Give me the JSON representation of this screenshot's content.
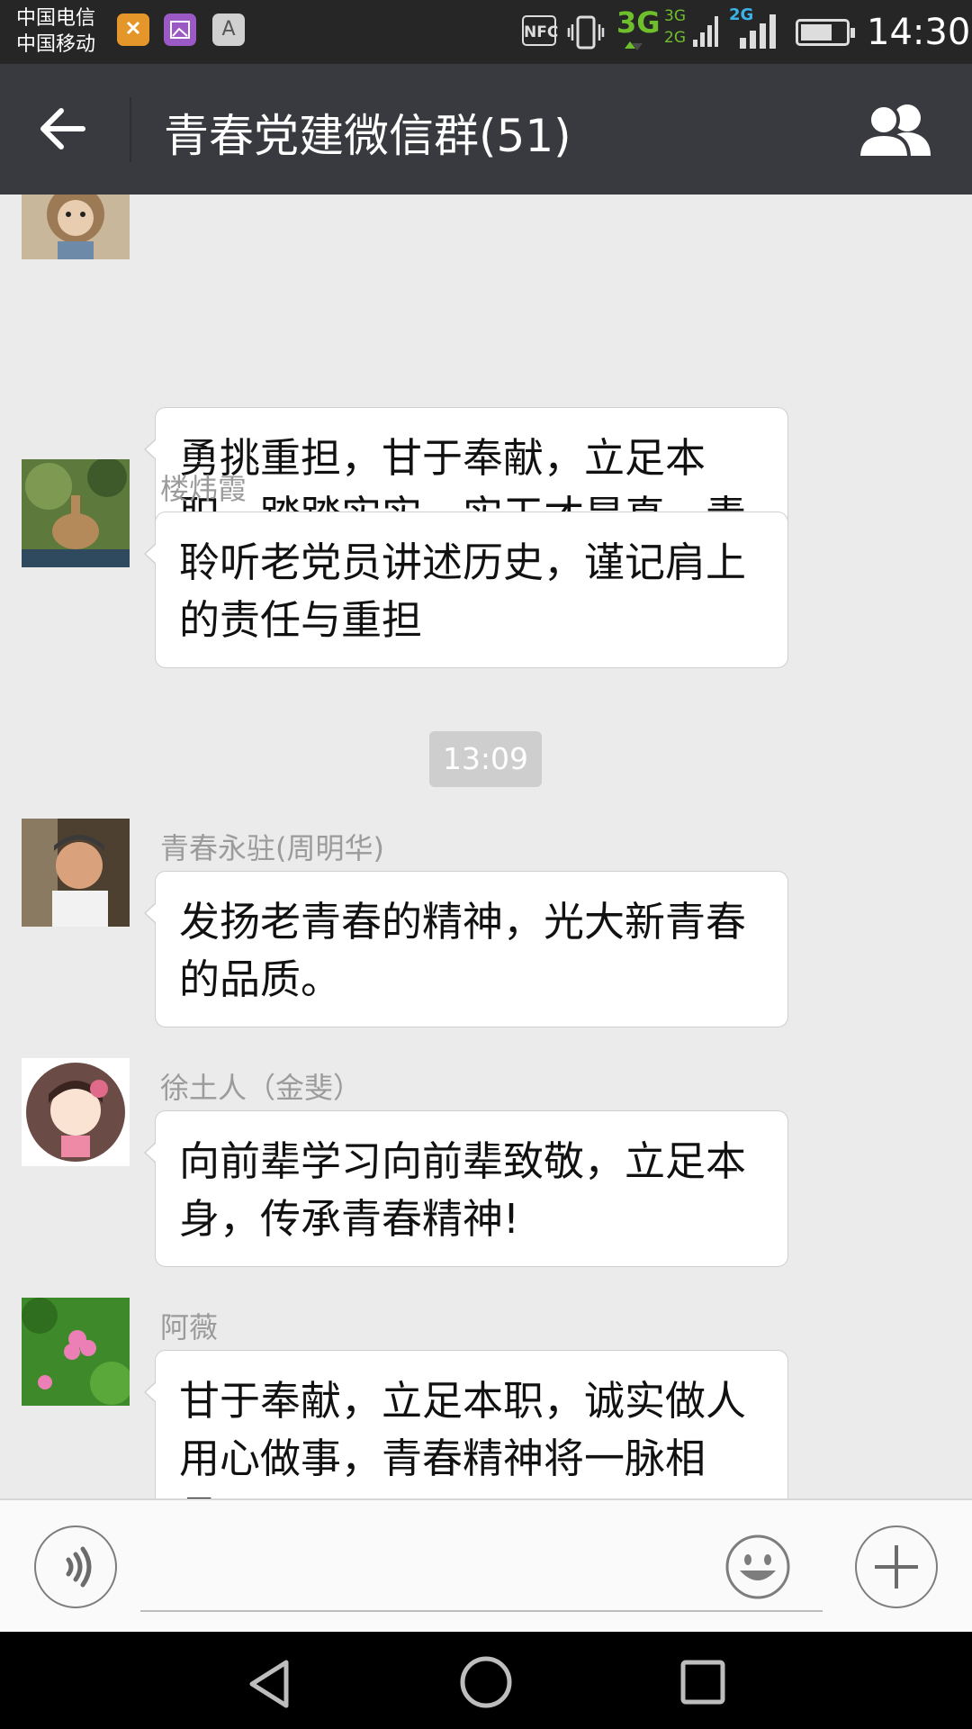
{
  "status_bar": {
    "carrier_1": "中国电信",
    "carrier_2": "中国移动",
    "nfc": "NFC",
    "network_3g": "3G",
    "network_dual": "3G 2G",
    "network_2g": "2G",
    "time": "14:30",
    "icons": [
      "music-app-icon",
      "gallery-app-icon",
      "keyboard-app-icon",
      "nfc-icon",
      "vibrate-icon",
      "signal-icon",
      "battery-icon"
    ]
  },
  "header": {
    "title": "青春党建微信群(51)",
    "back_icon": "back-arrow-icon",
    "members_icon": "group-members-icon"
  },
  "messages": [
    {
      "sender": "",
      "text": "勇挑重担，甘于奉献，立足本职，踏踏实实，实干才是真，青春精神将一脉相承。"
    },
    {
      "sender": "楼炜霞",
      "text": "聆听老党员讲述历史，谨记肩上的责任与重担"
    },
    {
      "sender": "青春永驻(周明华)",
      "text": "发扬老青春的精神，光大新青春的品质。"
    },
    {
      "sender": "徐土人（金斐）",
      "text": "向前辈学习向前辈致敬，立足本身，传承青春精神!"
    },
    {
      "sender": "阿薇",
      "text": "甘于奉献，立足本职，诚实做人用心做事，青春精神将一脉相承。"
    }
  ],
  "timestamp": "13:09",
  "input_bar": {
    "voice_icon": "voice-input-icon",
    "emoji_icon": "emoji-icon",
    "plus_icon": "plus-icon"
  },
  "nav_bar": {
    "icons": [
      "nav-back-icon",
      "nav-home-icon",
      "nav-recents-icon"
    ]
  },
  "colors": {
    "header_bg": "#393a3f",
    "chat_bg": "#ebebeb",
    "bubble_bg": "#ffffff",
    "status_bar_bg": "#262626",
    "network_green": "#6fbf2d",
    "network_blue": "#3ab3e8"
  }
}
